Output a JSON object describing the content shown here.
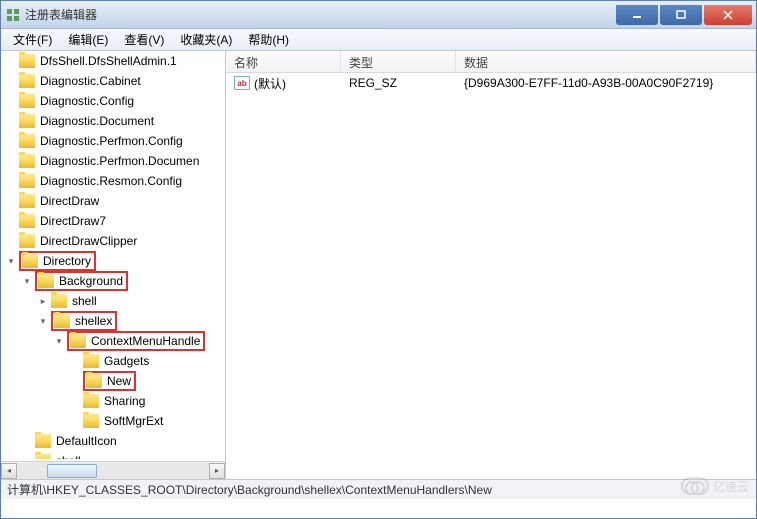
{
  "window": {
    "title": "注册表编辑器"
  },
  "menu": {
    "file": "文件(F)",
    "edit": "编辑(E)",
    "view": "查看(V)",
    "favorites": "收藏夹(A)",
    "help": "帮助(H)"
  },
  "tree": {
    "items": [
      {
        "label": "DfsShell.DfsShellAdmin.1",
        "indent": 0,
        "toggle": "",
        "highlight": false
      },
      {
        "label": "Diagnostic.Cabinet",
        "indent": 0,
        "toggle": "",
        "highlight": false
      },
      {
        "label": "Diagnostic.Config",
        "indent": 0,
        "toggle": "",
        "highlight": false
      },
      {
        "label": "Diagnostic.Document",
        "indent": 0,
        "toggle": "",
        "highlight": false
      },
      {
        "label": "Diagnostic.Perfmon.Config",
        "indent": 0,
        "toggle": "",
        "highlight": false
      },
      {
        "label": "Diagnostic.Perfmon.Documen",
        "indent": 0,
        "toggle": "",
        "highlight": false
      },
      {
        "label": "Diagnostic.Resmon.Config",
        "indent": 0,
        "toggle": "",
        "highlight": false
      },
      {
        "label": "DirectDraw",
        "indent": 0,
        "toggle": "",
        "highlight": false
      },
      {
        "label": "DirectDraw7",
        "indent": 0,
        "toggle": "",
        "highlight": false
      },
      {
        "label": "DirectDrawClipper",
        "indent": 0,
        "toggle": "",
        "highlight": false
      },
      {
        "label": "Directory",
        "indent": 0,
        "toggle": "▾",
        "highlight": true
      },
      {
        "label": "Background",
        "indent": 1,
        "toggle": "▾",
        "highlight": true
      },
      {
        "label": "shell",
        "indent": 2,
        "toggle": "▸",
        "highlight": false
      },
      {
        "label": "shellex",
        "indent": 2,
        "toggle": "▾",
        "highlight": true
      },
      {
        "label": "ContextMenuHandle",
        "indent": 3,
        "toggle": "▾",
        "highlight": true
      },
      {
        "label": "Gadgets",
        "indent": 4,
        "toggle": "",
        "highlight": false
      },
      {
        "label": "New",
        "indent": 4,
        "toggle": "",
        "highlight": true
      },
      {
        "label": "Sharing",
        "indent": 4,
        "toggle": "",
        "highlight": false
      },
      {
        "label": "SoftMgrExt",
        "indent": 4,
        "toggle": "",
        "highlight": false
      },
      {
        "label": "DefaultIcon",
        "indent": 1,
        "toggle": "",
        "highlight": false
      },
      {
        "label": "shell",
        "indent": 1,
        "toggle": "▸",
        "highlight": false
      }
    ]
  },
  "list": {
    "headers": {
      "name": "名称",
      "type": "类型",
      "data": "数据"
    },
    "rows": [
      {
        "name": "(默认)",
        "type": "REG_SZ",
        "data": "{D969A300-E7FF-11d0-A93B-00A0C90F2719}"
      }
    ]
  },
  "statusbar": {
    "path": "计算机\\HKEY_CLASSES_ROOT\\Directory\\Background\\shellex\\ContextMenuHandlers\\New"
  },
  "watermark": "亿速云"
}
